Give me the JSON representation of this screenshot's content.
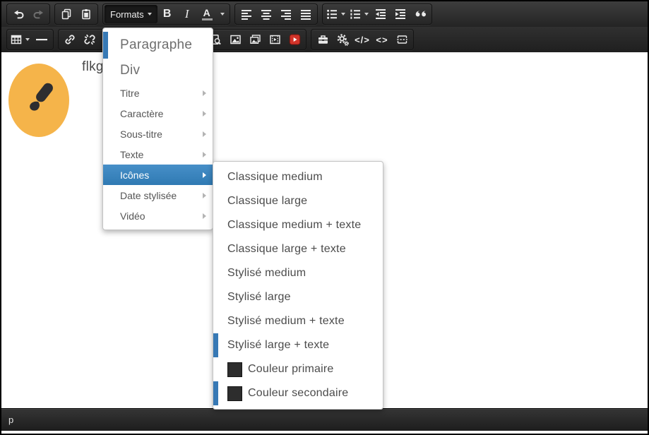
{
  "toolbar": {
    "formats_label": "Formats",
    "bold_label": "B",
    "italic_label": "I",
    "text_color_label": "A",
    "source_code_label": "&lt;/&gt;",
    "inline_code_label": "&lt;&gt;",
    "row1_icons": [
      "undo-icon",
      "redo-icon",
      "copy-icon",
      "paste-icon",
      "align-left-icon",
      "align-center-icon",
      "align-right-icon",
      "align-justify-icon",
      "bullet-list-icon",
      "numbered-list-icon",
      "outdent-icon",
      "indent-icon",
      "blockquote-icon"
    ],
    "row2_icons": [
      "table-icon",
      "horizontal-rule-icon",
      "link-icon",
      "unlink-icon",
      "browse-icon",
      "image-icon",
      "gallery-icon",
      "media-icon",
      "youtube-icon",
      "briefcase-icon",
      "settings-icon",
      "source-code-icon",
      "inline-code-icon",
      "page-break-icon"
    ]
  },
  "formats_menu": {
    "items": [
      {
        "label": "Paragraphe",
        "has_submenu": false
      },
      {
        "label": "Div",
        "has_submenu": false
      },
      {
        "label": "Titre",
        "has_submenu": true
      },
      {
        "label": "Caractère",
        "has_submenu": true
      },
      {
        "label": "Sous-titre",
        "has_submenu": true
      },
      {
        "label": "Texte",
        "has_submenu": true
      },
      {
        "label": "Icônes",
        "has_submenu": true,
        "selected": true
      },
      {
        "label": "Date stylisée",
        "has_submenu": true
      },
      {
        "label": "Vidéo",
        "has_submenu": true
      }
    ]
  },
  "icons_submenu": {
    "items": [
      {
        "label": "Classique medium"
      },
      {
        "label": "Classique large"
      },
      {
        "label": "Classique medium + texte"
      },
      {
        "label": "Classique large + texte"
      },
      {
        "label": "Stylisé medium"
      },
      {
        "label": "Stylisé large"
      },
      {
        "label": "Stylisé medium + texte"
      },
      {
        "label": "Stylisé large + texte",
        "left_bar": true
      },
      {
        "label": "Couleur primaire",
        "swatch": true
      },
      {
        "label": "Couleur secondaire",
        "swatch": true,
        "left_bar": true
      }
    ]
  },
  "editor": {
    "text": "flkg"
  },
  "statusbar": {
    "element_path": "p"
  },
  "colors": {
    "accent": "#3779b5",
    "hl-top": "#478fc8",
    "hl-bottom": "#2f7ab3",
    "avatar": "#f5b44a",
    "yt": "#d2342a",
    "swatch": "#2d2d2d"
  }
}
